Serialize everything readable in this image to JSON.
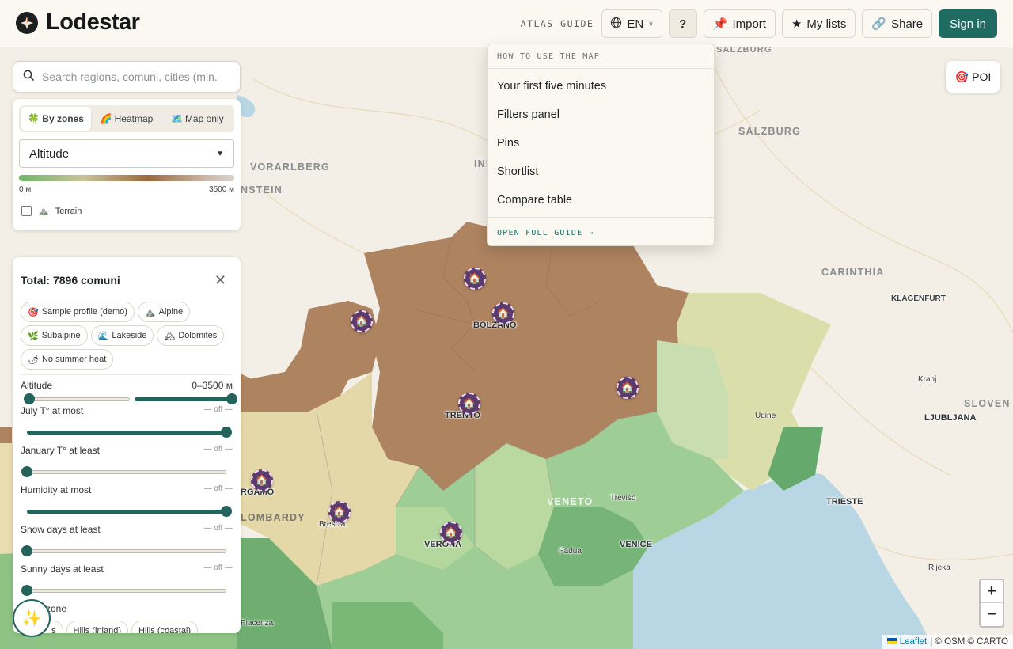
{
  "header": {
    "brand": "Lodestar",
    "atlas_guide": "ATLAS GUIDE",
    "language": "EN",
    "help": "?",
    "import": "Import",
    "my_lists": "My lists",
    "share": "Share",
    "sign_in": "Sign in"
  },
  "guide_menu": {
    "heading": "HOW TO USE THE MAP",
    "items": [
      "Your first five minutes",
      "Filters panel",
      "Pins",
      "Shortlist",
      "Compare table"
    ],
    "footer": "OPEN FULL GUIDE →"
  },
  "search": {
    "placeholder": "Search regions, comuni, cities (min."
  },
  "layers": {
    "modes": [
      {
        "icon": "🍀",
        "label": "By zones",
        "active": true
      },
      {
        "icon": "🌈",
        "label": "Heatmap",
        "active": false
      },
      {
        "icon": "🗺️",
        "label": "Map only",
        "active": false
      }
    ],
    "metric": "Altitude",
    "ramp_min": "0 м",
    "ramp_max": "3500 м",
    "terrain_icon": "⛰️",
    "terrain_label": "Terrain",
    "terrain_checked": false
  },
  "filters": {
    "title": "Total: 7896 comuni",
    "chips": [
      {
        "icon": "🎯",
        "label": "Sample profile (demo)"
      },
      {
        "icon": "⛰️",
        "label": "Alpine"
      },
      {
        "icon": "🌿",
        "label": "Subalpine"
      },
      {
        "icon": "🌊",
        "label": "Lakeside"
      },
      {
        "icon": "🏔",
        "label": "Dolomites"
      },
      {
        "icon": "🌶",
        "label": "No summer heat"
      }
    ],
    "sliders": [
      {
        "label": "Altitude",
        "value": "0–3500 м",
        "low": 0,
        "high": 1
      },
      {
        "label": "July T° at most",
        "value": "— off —",
        "low": 1,
        "high": 1
      },
      {
        "label": "January T° at least",
        "value": "— off —",
        "low": 0,
        "high": 0
      },
      {
        "label": "Humidity at most",
        "value": "— off —",
        "low": 1,
        "high": 1
      },
      {
        "label": "Snow days at least",
        "value": "— off —",
        "low": 0,
        "high": 0
      },
      {
        "label": "Sunny days at least",
        "value": "— off —",
        "low": 0,
        "high": 0
      }
    ],
    "zone_heading": "zone",
    "zone_chips": [
      "s",
      "Hills (inland)",
      "Hills (coastal)"
    ]
  },
  "map": {
    "region_labels": [
      "VORARLBERG",
      "NSTEIN",
      "INN",
      "SALZBURG",
      "SALZBURG",
      "CARINTHIA",
      "KLAGENFURT",
      "SLOVEN",
      "VENETO",
      "LOMBARDY"
    ],
    "cities": [
      "BOLZANO",
      "TRENTO",
      "VERONA",
      "VENICE",
      "TRIESTE",
      "LJUBLJANA",
      "RGAMO",
      "Brescia",
      "Padua",
      "Treviso",
      "Udine",
      "Kranj",
      "Rijeka",
      "Piacenza"
    ],
    "poi": "POI",
    "zoom_in": "+",
    "zoom_out": "−",
    "attribution_leaflet": "Leaflet",
    "attribution_rest": "| © OSM © CARTO"
  },
  "magic_button_icon": "✨"
}
